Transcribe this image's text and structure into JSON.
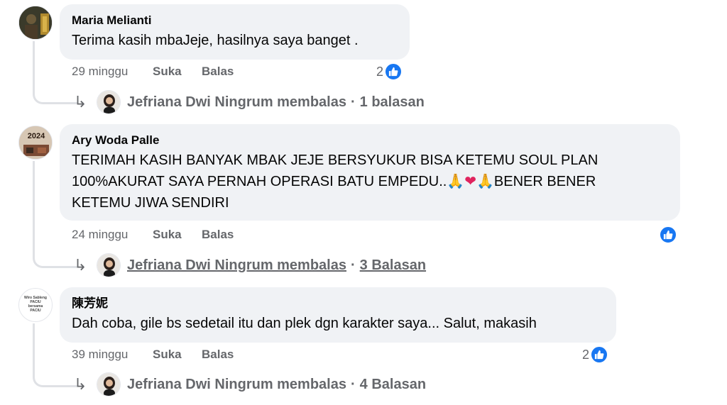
{
  "comments": [
    {
      "author": "Maria Melianti",
      "text_lines": [
        "Terima kasih mbaJeje, hasilnya saya banget ."
      ],
      "time": "29 minggu",
      "like_label": "Suka",
      "reply_label": "Balas",
      "reaction_count": "2",
      "reply_author": "Jefriana Dwi Ningrum membalas",
      "reply_count": "1 balasan"
    },
    {
      "author": "Ary Woda Palle",
      "text_lines": [
        "TERIMAH KASIH BANYAK MBAK JEJE BERSYUKUR BISA KETEMU SOUL PLAN",
        "100%AKURAT SAYA PERNAH OPERASI BATU EMPEDU..",
        "BENER BENER",
        "KETEMU JIWA SENDIRI"
      ],
      "emoji": [
        "🙏",
        "❤",
        "🙏"
      ],
      "avatar_text": "2024",
      "time": "24 minggu",
      "like_label": "Suka",
      "reply_label": "Balas",
      "reaction_count": "",
      "reply_author": "Jefriana Dwi Ningrum membalas",
      "reply_count": "3 Balasan"
    },
    {
      "author": "陳芳妮",
      "text_lines": [
        "Dah coba, gile bs sedetail itu dan plek dgn karakter saya... Salut, makasih"
      ],
      "avatar_text": [
        "Wiro Sableng",
        "PACIU",
        "bersama",
        "PACIU"
      ],
      "time": "39 minggu",
      "like_label": "Suka",
      "reply_label": "Balas",
      "reaction_count": "2",
      "reply_author": "Jefriana Dwi Ningrum membalas",
      "reply_count": "4 Balasan"
    }
  ],
  "separator": "·",
  "colors": {
    "like_blue": "#1877f2",
    "bubble": "#f0f2f5",
    "meta": "#65676b"
  }
}
